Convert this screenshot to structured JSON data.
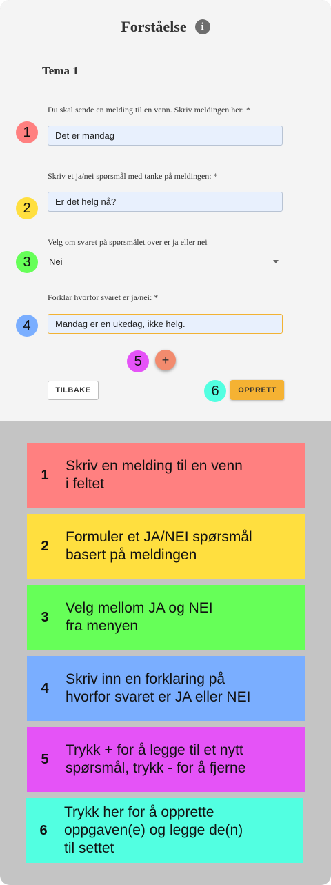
{
  "header": {
    "title": "Forståelse",
    "info_icon": "i"
  },
  "section_title": "Tema 1",
  "fields": {
    "message_label": "Du skal sende en melding til en venn. Skriv meldingen her: *",
    "message_value": "Det er mandag",
    "question_label": "Skriv et ja/nei spørsmål med tanke på meldingen: *",
    "question_value": "Er det helg nå?",
    "answer_label": "Velg om svaret på spørsmålet over er ja eller nei",
    "answer_value": "Nei",
    "reason_label": "Forklar hvorfor svaret er ja/nei: *",
    "reason_value": "Mandag er en ukedag, ikke helg."
  },
  "badges": [
    "1",
    "2",
    "3",
    "4",
    "5",
    "6"
  ],
  "buttons": {
    "add": "+",
    "back": "TILBAKE",
    "create": "OPPRETT"
  },
  "legend": [
    {
      "num": "1",
      "text": "Skriv en melding til en venn\ni feltet",
      "color": "#ff8080"
    },
    {
      "num": "2",
      "text": "Formuler et JA/NEI spørsmål\nbasert på meldingen",
      "color": "#ffdf3f"
    },
    {
      "num": "3",
      "text": "Velg mellom JA og NEI\nfra menyen",
      "color": "#66ff58"
    },
    {
      "num": "4",
      "text": "Skriv inn en forklaring på\nhvorfor svaret er JA eller NEI",
      "color": "#7aaeff"
    },
    {
      "num": "5",
      "text": "Trykk + for å legge til et nytt\nspørsmål, trykk - for å fjerne",
      "color": "#e553f7"
    },
    {
      "num": "6",
      "text": "Trykk her for å opprette\noppgaven(e) og legge de(n)\ntil settet",
      "color": "#52ffe1"
    }
  ],
  "colors": {
    "badge1": "#ff8080",
    "badge2": "#ffdf3f",
    "badge3": "#66ff58",
    "badge4": "#7aaeff",
    "badge5": "#e553f7",
    "badge6": "#52ffe1",
    "accent": "#f5b233"
  }
}
